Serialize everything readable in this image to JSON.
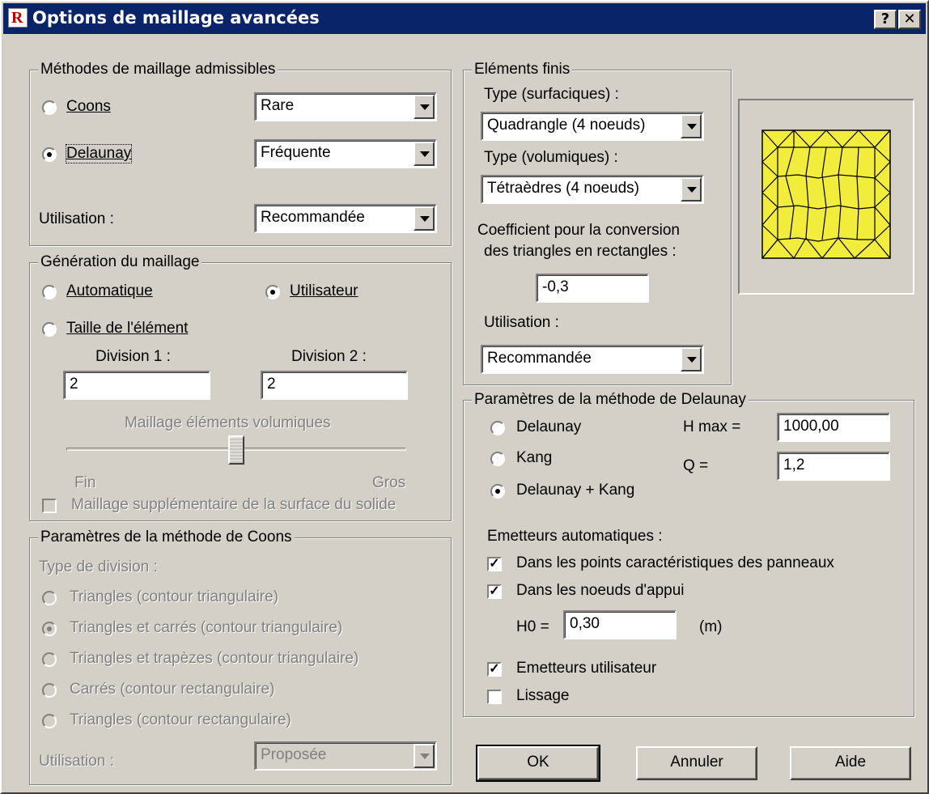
{
  "window": {
    "title": "Options de maillage avancées",
    "help_button": "?",
    "close_button": "✕"
  },
  "methods": {
    "legend": "Méthodes de maillage admissibles",
    "coons_label": "Coons",
    "coons_value": "Rare",
    "delaunay_label": "Delaunay",
    "delaunay_value": "Fréquente",
    "selected": "delaunay",
    "usage_label": "Utilisation :",
    "usage_value": "Recommandée"
  },
  "generation": {
    "legend": "Génération du maillage",
    "auto_label": "Automatique",
    "user_label": "Utilisateur",
    "size_label": "Taille de l'élément",
    "selected": "user",
    "div1_label": "Division 1 :",
    "div1_value": "2",
    "div2_label": "Division 2 :",
    "div2_value": "2",
    "slider_title": "Maillage éléments volumiques",
    "slider_min": "Fin",
    "slider_max": "Gros",
    "slider_position": 0.5,
    "extra_label": "Maillage supplémentaire de la surface du solide",
    "extra_checked": false
  },
  "coons": {
    "legend": "Paramètres de la méthode de Coons",
    "division_type": "Type de division :",
    "options": [
      "Triangles (contour triangulaire)",
      "Triangles et carrés (contour triangulaire)",
      "Triangles et trapèzes (contour triangulaire)",
      "Carrés (contour rectangulaire)",
      "Triangles (contour rectangulaire)"
    ],
    "selected_index": 1,
    "usage_label": "Utilisation :",
    "usage_value": "Proposée"
  },
  "fe": {
    "legend": "Eléments finis",
    "surf_label": "Type (surfaciques) :",
    "surf_value": "Quadrangle (4 noeuds)",
    "vol_label": "Type (volumiques) :",
    "vol_value": "Tétraèdres (4 noeuds)",
    "coef_label_1": "Coefficient pour la conversion",
    "coef_label_2": "des triangles en rectangles :",
    "coef_value": "-0,3",
    "usage_label": "Utilisation :",
    "usage_value": "Recommandée"
  },
  "delaunay": {
    "legend": "Paramètres de la méthode de Delaunay",
    "opt1": "Delaunay",
    "opt2": "Kang",
    "opt3": "Delaunay + Kang",
    "selected": "delaunay_kang",
    "hmax_label": "H max =",
    "hmax_value": "1000,00",
    "q_label": "Q =",
    "q_value": "1,2",
    "emitters_label": "Emetteurs automatiques :",
    "cb1_label": "Dans les points caractéristiques des panneaux",
    "cb1_checked": true,
    "cb2_label": "Dans les noeuds d'appui",
    "cb2_checked": true,
    "h0_label": "H0 =",
    "h0_value": "0,30",
    "h0_unit": "(m)",
    "cb3_label": "Emetteurs utilisateur",
    "cb3_checked": true,
    "cb4_label": "Lissage",
    "cb4_checked": false
  },
  "buttons": {
    "ok": "OK",
    "cancel": "Annuler",
    "help": "Aide"
  },
  "colors": {
    "title_bar": "#0a246a",
    "mesh_fill": "#f2ec3c"
  }
}
